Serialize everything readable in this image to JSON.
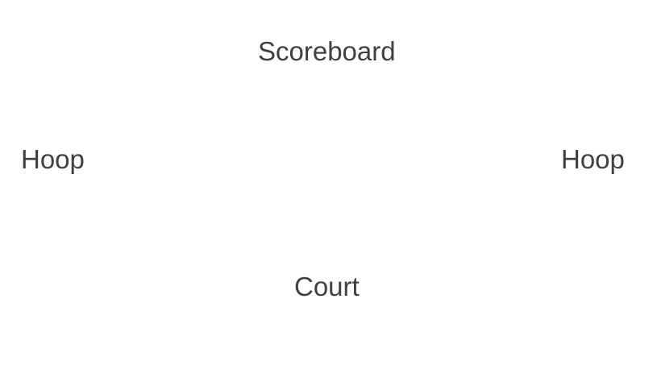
{
  "labels": {
    "scoreboard": "Scoreboard",
    "hoop_left": "Hoop",
    "hoop_right": "Hoop",
    "court": "Court"
  },
  "colors": {
    "background": "#ffffff",
    "text": "#404040"
  }
}
